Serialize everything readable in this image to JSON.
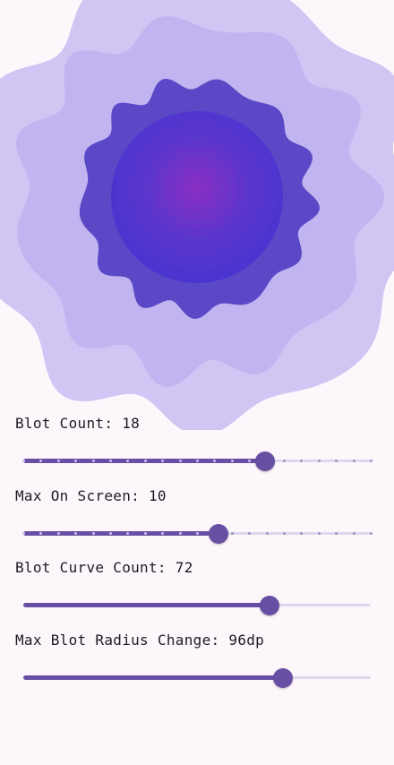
{
  "colors": {
    "background": "#fdf7fc",
    "accent": "#6750a4",
    "blot_outer": "#c9bcf2",
    "blot_middle": "#b5a6ec",
    "blot_inner": "#5a48c6",
    "blot_core": "#4a34d0",
    "blot_center": "#8a2ec2",
    "track_inactive": "#dcd8ee"
  },
  "controls": [
    {
      "label": "Blot Count: 18",
      "fraction": 0.695,
      "ticks": true,
      "tick_count": 21
    },
    {
      "label": "Max On Screen: 10",
      "fraction": 0.561,
      "ticks": true,
      "tick_count": 21
    },
    {
      "label": "Blot Curve Count: 72",
      "fraction": 0.709,
      "ticks": false
    },
    {
      "label": "Max Blot Radius Change: 96dp",
      "fraction": 0.748,
      "ticks": false
    }
  ]
}
